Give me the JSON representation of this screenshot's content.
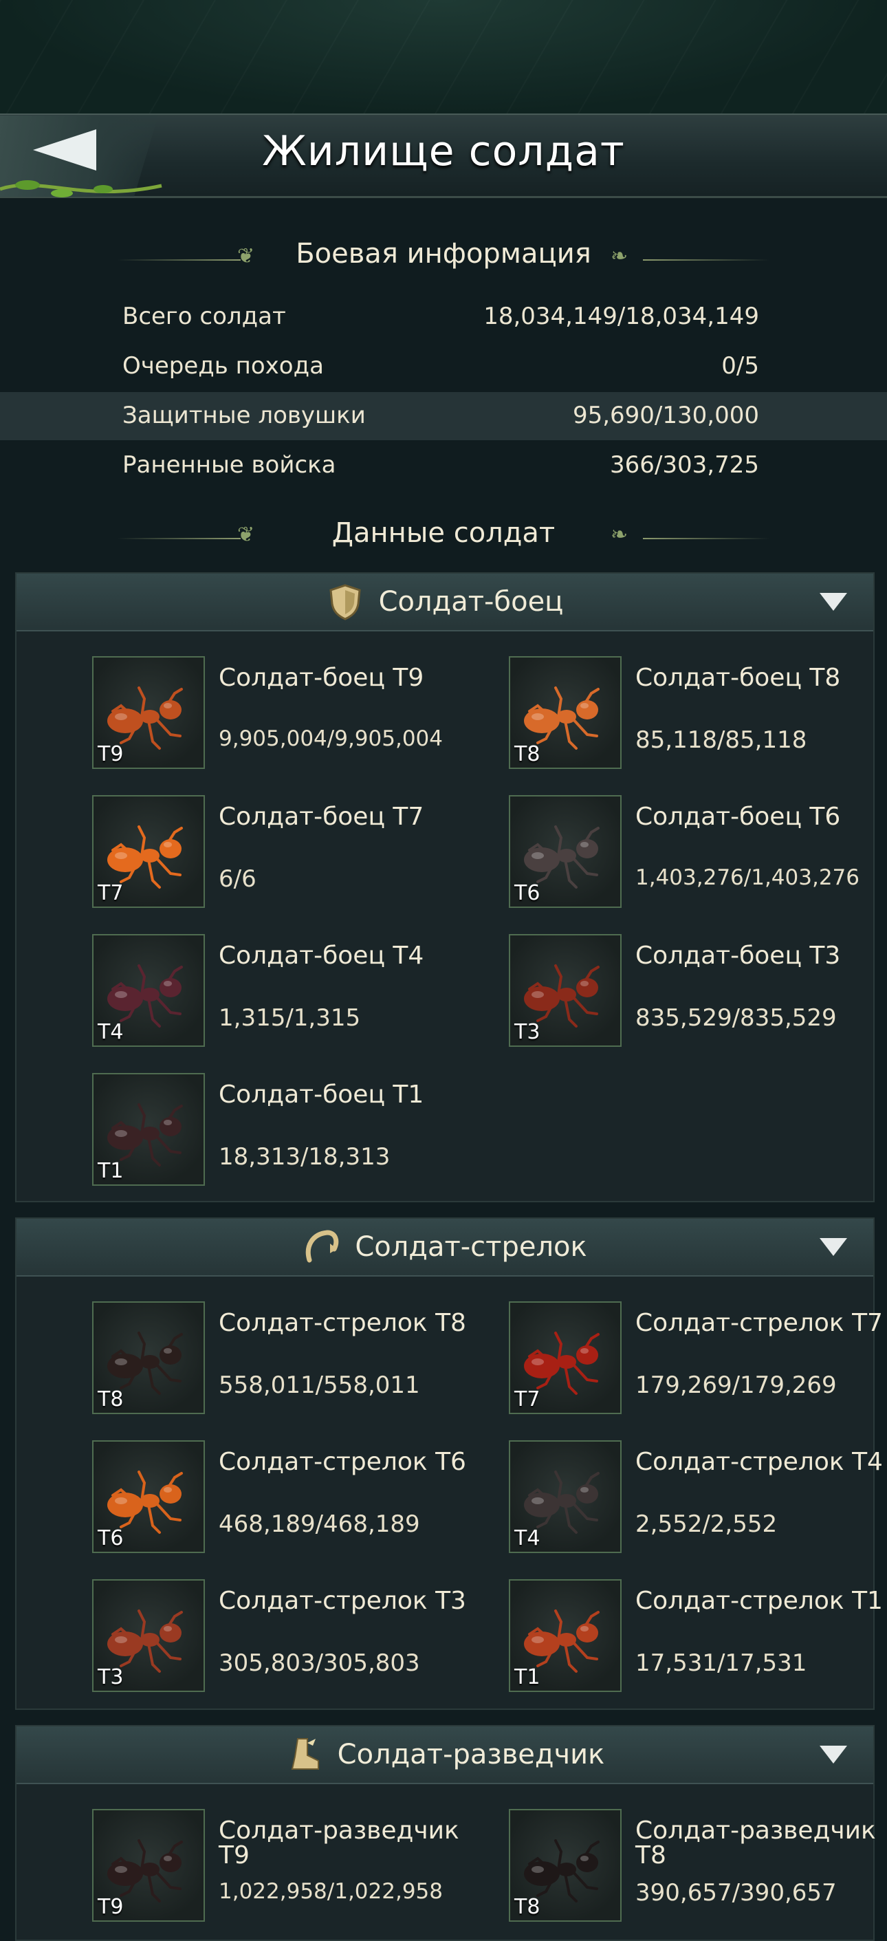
{
  "header": {
    "title": "Жилище солдат"
  },
  "combat_info": {
    "title": "Боевая информация",
    "rows": [
      {
        "label": "Всего солдат",
        "value": "18,034,149/18,034,149"
      },
      {
        "label": "Очередь похода",
        "value": "0/5"
      },
      {
        "label": "Защитные ловушки",
        "value": "95,690/130,000"
      },
      {
        "label": "Раненные войска",
        "value": "366/303,725"
      }
    ]
  },
  "soldier_data": {
    "title": "Данные солдат"
  },
  "categories": [
    {
      "label": "Солдат-боец",
      "icon": "shield-icon",
      "units": [
        {
          "name": "Солдат-боец T9",
          "count": "9,905,004/9,905,004",
          "tier": "T9",
          "color": "#c0501f"
        },
        {
          "name": "Солдат-боец T8",
          "count": "85,118/85,118",
          "tier": "T8",
          "color": "#d86a2a"
        },
        {
          "name": "Солдат-боец T7",
          "count": "6/6",
          "tier": "T7",
          "color": "#e46a1e"
        },
        {
          "name": "Солдат-боец T6",
          "count": "1,403,276/1,403,276",
          "tier": "T6",
          "color": "#4a4040"
        },
        {
          "name": "Солдат-боец T4",
          "count": "1,315/1,315",
          "tier": "T4",
          "color": "#5a2430"
        },
        {
          "name": "Солдат-боец T3",
          "count": "835,529/835,529",
          "tier": "T3",
          "color": "#8a2a1a"
        },
        {
          "name": "Солдат-боец T1",
          "count": "18,313/18,313",
          "tier": "T1",
          "color": "#3a2224"
        }
      ]
    },
    {
      "label": "Солдат-стрелок",
      "icon": "bow-icon",
      "units": [
        {
          "name": "Солдат-стрелок T8",
          "count": "558,011/558,011",
          "tier": "T8",
          "color": "#2a1e1c"
        },
        {
          "name": "Солдат-стрелок T7",
          "count": "179,269/179,269",
          "tier": "T7",
          "color": "#a82014"
        },
        {
          "name": "Солдат-стрелок T6",
          "count": "468,189/468,189",
          "tier": "T6",
          "color": "#d9631c"
        },
        {
          "name": "Солдат-стрелок T4",
          "count": "2,552/2,552",
          "tier": "T4",
          "color": "#3c3434"
        },
        {
          "name": "Солдат-стрелок T3",
          "count": "305,803/305,803",
          "tier": "T3",
          "color": "#9a3a22"
        },
        {
          "name": "Солдат-стрелок T1",
          "count": "17,531/17,531",
          "tier": "T1",
          "color": "#b4401e"
        }
      ]
    },
    {
      "label": "Солдат-разведчик",
      "icon": "boot-icon",
      "units": [
        {
          "name": "Солдат-разведчик T9",
          "count": "1,022,958/1,022,958",
          "tier": "T9",
          "color": "#2a1c1c"
        },
        {
          "name": "Солдат-разведчик T8",
          "count": "390,657/390,657",
          "tier": "T8",
          "color": "#1e1818"
        }
      ]
    }
  ]
}
